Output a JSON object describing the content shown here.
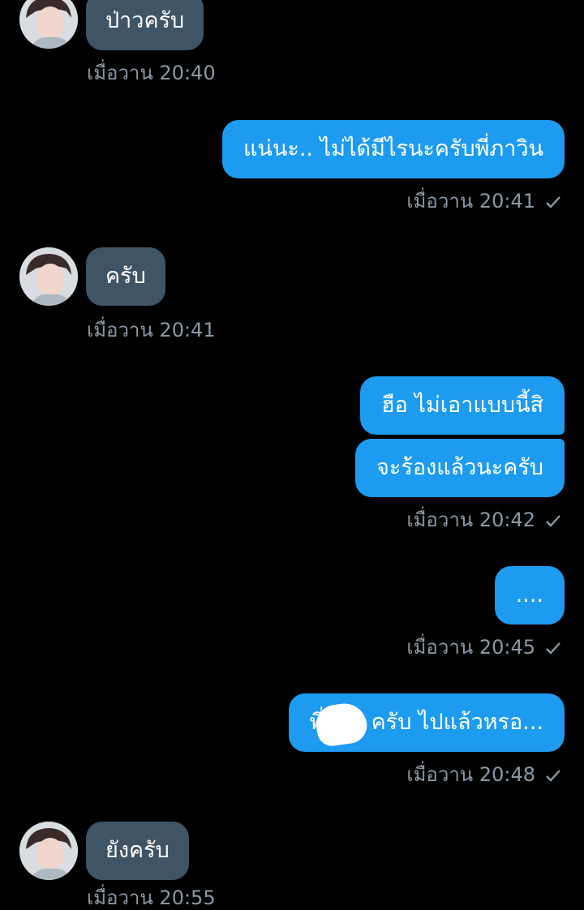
{
  "messages": [
    {
      "text": "ป่าวครับ",
      "time": "เมื่อวาน 20:40"
    },
    {
      "text": "แน่นะ.. ไม่ได้มีไรนะครับพี่ภาวิน",
      "time": "เมื่อวาน 20:41"
    },
    {
      "text": "ครับ",
      "time": "เมื่อวาน 20:41"
    },
    {
      "text": "ฮือ ไม่เอาแบบนี้สิ"
    },
    {
      "text": "จะร้องแล้วนะครับ",
      "time": "เมื่อวาน 20:42"
    },
    {
      "text": "....",
      "time": "เมื่อวาน 20:45"
    },
    {
      "text": "พี่",
      "text2": "ครับ ไปแล้วหรอ...",
      "time": "เมื่อวาน 20:48"
    },
    {
      "text": "ยังครับ",
      "time": "เมื่อวาน 20:55"
    }
  ],
  "colors": {
    "background": "#000000",
    "incoming_bubble": "#3f5566",
    "outgoing_bubble": "#1d9bf0",
    "timestamp": "#8b98a5"
  },
  "icons": {
    "sent": "check-icon",
    "avatar": "avatar-icon"
  }
}
